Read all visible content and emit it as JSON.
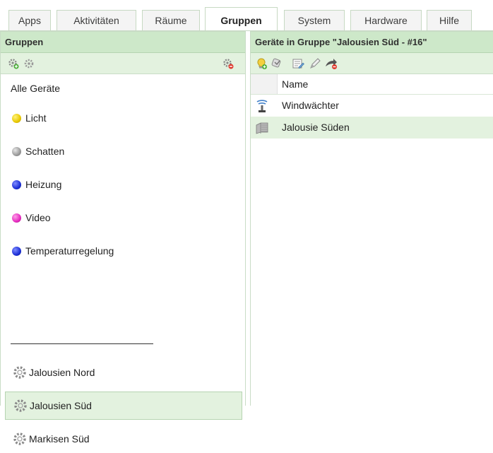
{
  "tabs": [
    "Apps",
    "Aktivitäten",
    "Räume",
    "Gruppen",
    "System",
    "Hardware",
    "Hilfe"
  ],
  "active_tab": "Gruppen",
  "left_panel": {
    "title": "Gruppen",
    "all_devices": "Alle Geräte",
    "categories": [
      {
        "label": "Licht",
        "color": "#e8c800"
      },
      {
        "label": "Schatten",
        "color": "#9a9a9a"
      },
      {
        "label": "Heizung",
        "color": "#1c2fd6"
      },
      {
        "label": "Video",
        "color": "#e52bbf"
      },
      {
        "label": "Temperaturregelung",
        "color": "#1c2fd6"
      }
    ],
    "groups": [
      "Jalousien Nord",
      "Jalousien Süd",
      "Markisen Süd"
    ],
    "selected_group": "Jalousien Süd"
  },
  "right_panel": {
    "title": "Geräte in Gruppe \"Jalousien Süd - #16\"",
    "column_name": "Name",
    "rows": [
      {
        "name": "Windwächter",
        "icon": "wind-sensor-icon"
      },
      {
        "name": "Jalousie Süden",
        "icon": "blind-icon"
      }
    ],
    "selected_row": "Jalousie Süden"
  },
  "colors": {
    "accent": "#cde8c9",
    "selection": "#e3f2df",
    "border": "#b6d4b1"
  }
}
